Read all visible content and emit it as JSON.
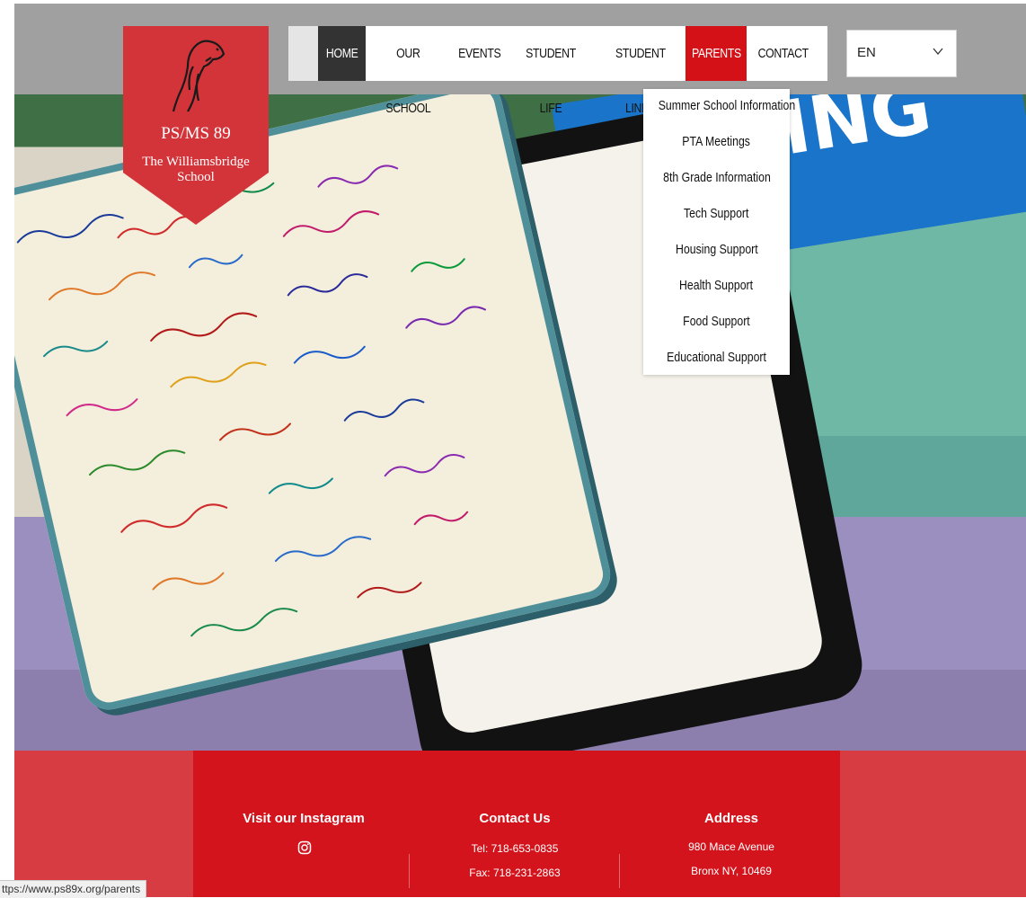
{
  "logo": {
    "title": "PS/MS 89",
    "subtitle": "The Williamsbridge School"
  },
  "nav": {
    "items": [
      {
        "label": "HOME",
        "state": "active"
      },
      {
        "label": "OUR SCHOOL"
      },
      {
        "label": "EVENTS"
      },
      {
        "label": "STUDENT LIFE"
      },
      {
        "label": "STUDENT LINKS"
      },
      {
        "label": "PARENTS",
        "state": "hovered"
      },
      {
        "label": "CONTACT"
      }
    ]
  },
  "language": {
    "value": "EN"
  },
  "parents_menu": [
    "Summer School Information",
    "PTA Meetings",
    "8th Grade Information",
    "Tech Support",
    "Housing Support",
    "Health Support",
    "Food Support",
    "Educational Support"
  ],
  "footer": {
    "instagram": {
      "heading": "Visit our Instagram",
      "icon": "instagram-icon"
    },
    "contact": {
      "heading": "Contact Us",
      "tel": "Tel: 718-653-0835",
      "fax": "Fax: 718-231-2863"
    },
    "address": {
      "heading": "Address",
      "line1": "980 Mace Avenue",
      "line2": "Bronx NY, 10469"
    }
  },
  "status_bar": {
    "url": "ttps://www.ps89x.org/parents"
  },
  "colors": {
    "brand_red": "#d31117",
    "logo_red": "#d2343a",
    "nav_active": "#333333",
    "topbar_gray": "#a0a0a0"
  }
}
